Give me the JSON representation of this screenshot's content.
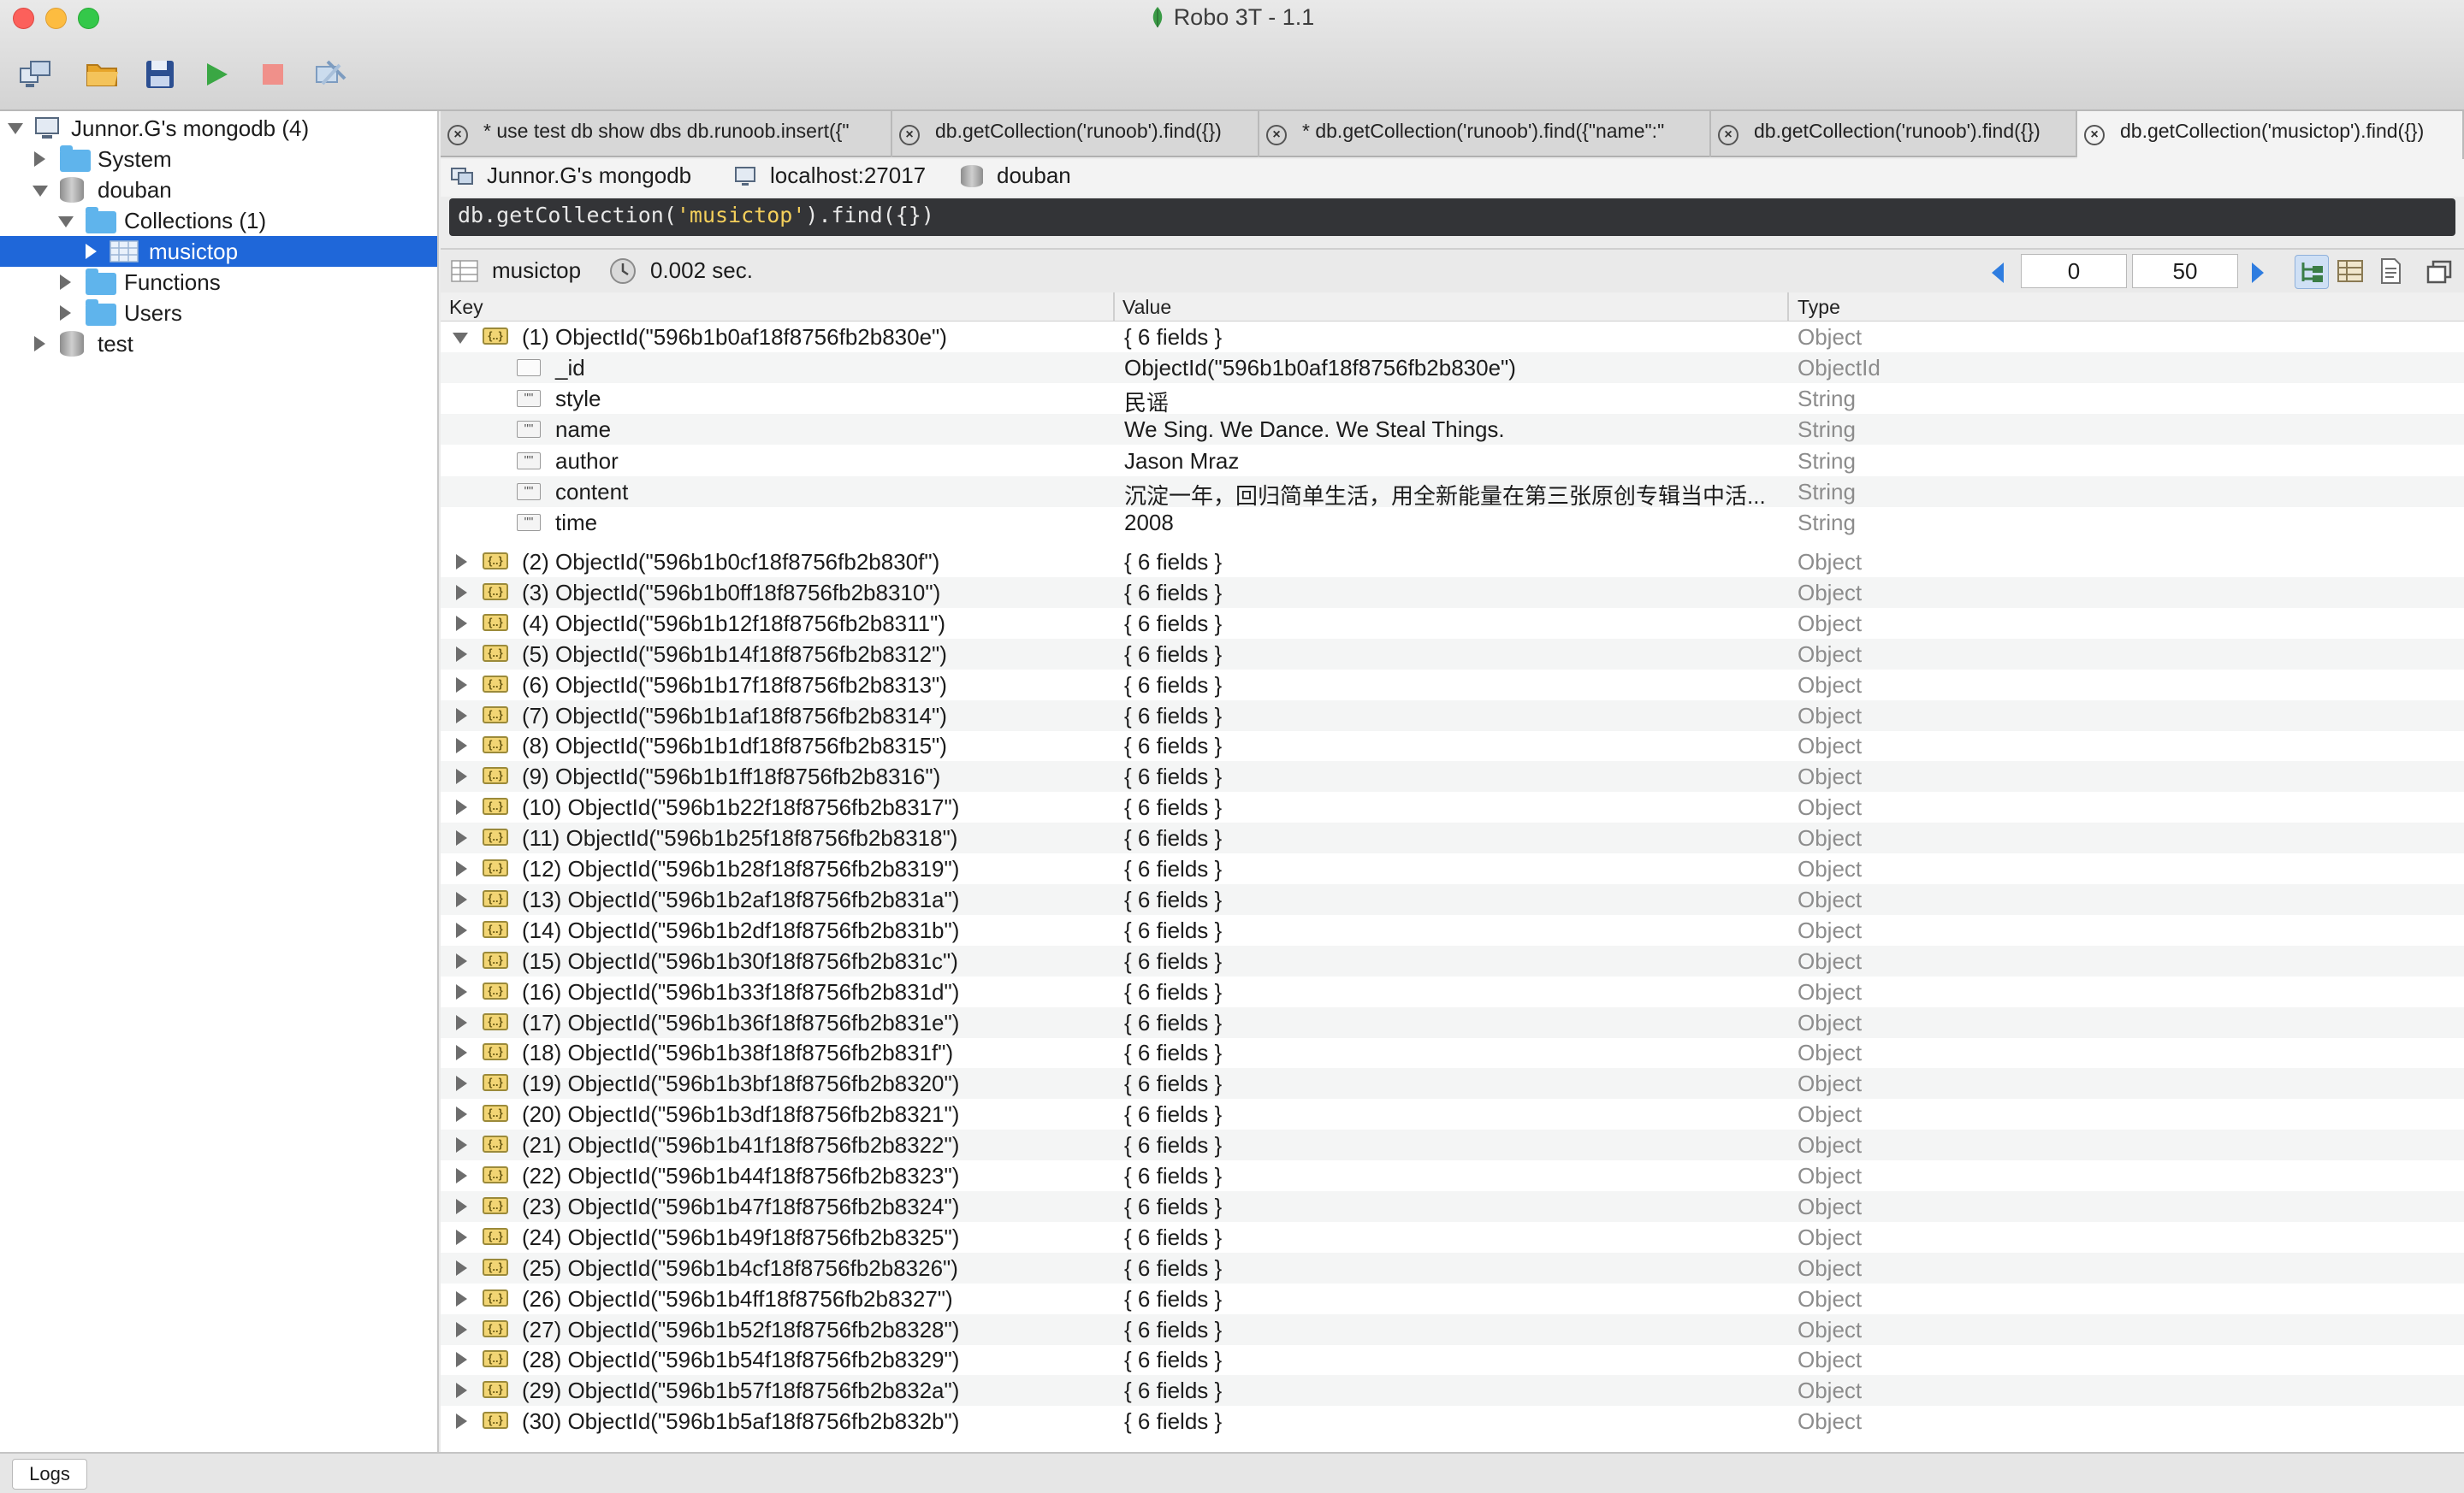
{
  "window": {
    "title": "Robo 3T - 1.1"
  },
  "toolbar": {
    "buttons": [
      {
        "name": "connect-button",
        "icon": "connect-icon"
      },
      {
        "name": "open-button",
        "icon": "folder-open-icon"
      },
      {
        "name": "save-button",
        "icon": "save-icon"
      },
      {
        "name": "execute-button",
        "icon": "play-icon"
      },
      {
        "name": "stop-button",
        "icon": "stop-icon"
      },
      {
        "name": "orient-button",
        "icon": "orient-icon"
      }
    ]
  },
  "sidebar": {
    "connection": "Junnor.G's mongodb (4)",
    "items": [
      {
        "label": "System"
      },
      {
        "label": "douban"
      },
      {
        "label": "Collections (1)"
      },
      {
        "label": "musictop"
      },
      {
        "label": "Functions"
      },
      {
        "label": "Users"
      },
      {
        "label": "test"
      }
    ]
  },
  "tabs": [
    {
      "label": "* use test db show dbs  db.runoob.insert({\""
    },
    {
      "label": "db.getCollection('runoob').find({})"
    },
    {
      "label": "* db.getCollection('runoob').find({\"name\":\""
    },
    {
      "label": "db.getCollection('runoob').find({})"
    },
    {
      "label": "db.getCollection('musictop').find({})"
    }
  ],
  "connbar": {
    "server": "Junnor.G's mongodb",
    "host": "localhost:27017",
    "database": "douban"
  },
  "query": {
    "prefix": "db.getCollection(",
    "arg": "'musictop'",
    "suffix": ").find({})"
  },
  "results": {
    "collection": "musictop",
    "time": "0.002 sec.",
    "skip": "0",
    "limit": "50"
  },
  "columns": {
    "key": "Key",
    "value": "Value",
    "type": "Type"
  },
  "first_doc": {
    "key": "(1) ObjectId(\"596b1b0af18f8756fb2b830e\")",
    "value": "{ 6 fields }",
    "type": "Object",
    "fields": [
      {
        "key": "_id",
        "value": "ObjectId(\"596b1b0af18f8756fb2b830e\")",
        "type": "ObjectId",
        "icon": "id-icon"
      },
      {
        "key": "style",
        "value": "民谣",
        "type": "String",
        "icon": "string-icon"
      },
      {
        "key": "name",
        "value": "We Sing. We Dance. We Steal Things.",
        "type": "String",
        "icon": "string-icon"
      },
      {
        "key": "author",
        "value": "Jason Mraz",
        "type": "String",
        "icon": "string-icon"
      },
      {
        "key": "content",
        "value": "沉淀一年，回归简单生活，用全新能量在第三张原创专辑当中活...",
        "type": "String",
        "icon": "string-icon"
      },
      {
        "key": "time",
        "value": "2008",
        "type": "String",
        "icon": "string-icon"
      }
    ]
  },
  "docs": [
    {
      "key": "(2) ObjectId(\"596b1b0cf18f8756fb2b830f\")",
      "value": "{ 6 fields }",
      "type": "Object"
    },
    {
      "key": "(3) ObjectId(\"596b1b0ff18f8756fb2b8310\")",
      "value": "{ 6 fields }",
      "type": "Object"
    },
    {
      "key": "(4) ObjectId(\"596b1b12f18f8756fb2b8311\")",
      "value": "{ 6 fields }",
      "type": "Object"
    },
    {
      "key": "(5) ObjectId(\"596b1b14f18f8756fb2b8312\")",
      "value": "{ 6 fields }",
      "type": "Object"
    },
    {
      "key": "(6) ObjectId(\"596b1b17f18f8756fb2b8313\")",
      "value": "{ 6 fields }",
      "type": "Object"
    },
    {
      "key": "(7) ObjectId(\"596b1b1af18f8756fb2b8314\")",
      "value": "{ 6 fields }",
      "type": "Object"
    },
    {
      "key": "(8) ObjectId(\"596b1b1df18f8756fb2b8315\")",
      "value": "{ 6 fields }",
      "type": "Object"
    },
    {
      "key": "(9) ObjectId(\"596b1b1ff18f8756fb2b8316\")",
      "value": "{ 6 fields }",
      "type": "Object"
    },
    {
      "key": "(10) ObjectId(\"596b1b22f18f8756fb2b8317\")",
      "value": "{ 6 fields }",
      "type": "Object"
    },
    {
      "key": "(11) ObjectId(\"596b1b25f18f8756fb2b8318\")",
      "value": "{ 6 fields }",
      "type": "Object"
    },
    {
      "key": "(12) ObjectId(\"596b1b28f18f8756fb2b8319\")",
      "value": "{ 6 fields }",
      "type": "Object"
    },
    {
      "key": "(13) ObjectId(\"596b1b2af18f8756fb2b831a\")",
      "value": "{ 6 fields }",
      "type": "Object"
    },
    {
      "key": "(14) ObjectId(\"596b1b2df18f8756fb2b831b\")",
      "value": "{ 6 fields }",
      "type": "Object"
    },
    {
      "key": "(15) ObjectId(\"596b1b30f18f8756fb2b831c\")",
      "value": "{ 6 fields }",
      "type": "Object"
    },
    {
      "key": "(16) ObjectId(\"596b1b33f18f8756fb2b831d\")",
      "value": "{ 6 fields }",
      "type": "Object"
    },
    {
      "key": "(17) ObjectId(\"596b1b36f18f8756fb2b831e\")",
      "value": "{ 6 fields }",
      "type": "Object"
    },
    {
      "key": "(18) ObjectId(\"596b1b38f18f8756fb2b831f\")",
      "value": "{ 6 fields }",
      "type": "Object"
    },
    {
      "key": "(19) ObjectId(\"596b1b3bf18f8756fb2b8320\")",
      "value": "{ 6 fields }",
      "type": "Object"
    },
    {
      "key": "(20) ObjectId(\"596b1b3df18f8756fb2b8321\")",
      "value": "{ 6 fields }",
      "type": "Object"
    },
    {
      "key": "(21) ObjectId(\"596b1b41f18f8756fb2b8322\")",
      "value": "{ 6 fields }",
      "type": "Object"
    },
    {
      "key": "(22) ObjectId(\"596b1b44f18f8756fb2b8323\")",
      "value": "{ 6 fields }",
      "type": "Object"
    },
    {
      "key": "(23) ObjectId(\"596b1b47f18f8756fb2b8324\")",
      "value": "{ 6 fields }",
      "type": "Object"
    },
    {
      "key": "(24) ObjectId(\"596b1b49f18f8756fb2b8325\")",
      "value": "{ 6 fields }",
      "type": "Object"
    },
    {
      "key": "(25) ObjectId(\"596b1b4cf18f8756fb2b8326\")",
      "value": "{ 6 fields }",
      "type": "Object"
    },
    {
      "key": "(26) ObjectId(\"596b1b4ff18f8756fb2b8327\")",
      "value": "{ 6 fields }",
      "type": "Object"
    },
    {
      "key": "(27) ObjectId(\"596b1b52f18f8756fb2b8328\")",
      "value": "{ 6 fields }",
      "type": "Object"
    },
    {
      "key": "(28) ObjectId(\"596b1b54f18f8756fb2b8329\")",
      "value": "{ 6 fields }",
      "type": "Object"
    },
    {
      "key": "(29) ObjectId(\"596b1b57f18f8756fb2b832a\")",
      "value": "{ 6 fields }",
      "type": "Object"
    },
    {
      "key": "(30) ObjectId(\"596b1b5af18f8756fb2b832b\")",
      "value": "{ 6 fields }",
      "type": "Object"
    }
  ],
  "statusbar": {
    "logs_label": "Logs"
  },
  "colors": {
    "selection": "#1f67d9",
    "type_text": "#8c8c8c",
    "query_bg": "#333437",
    "query_string": "#f4cf5b"
  }
}
